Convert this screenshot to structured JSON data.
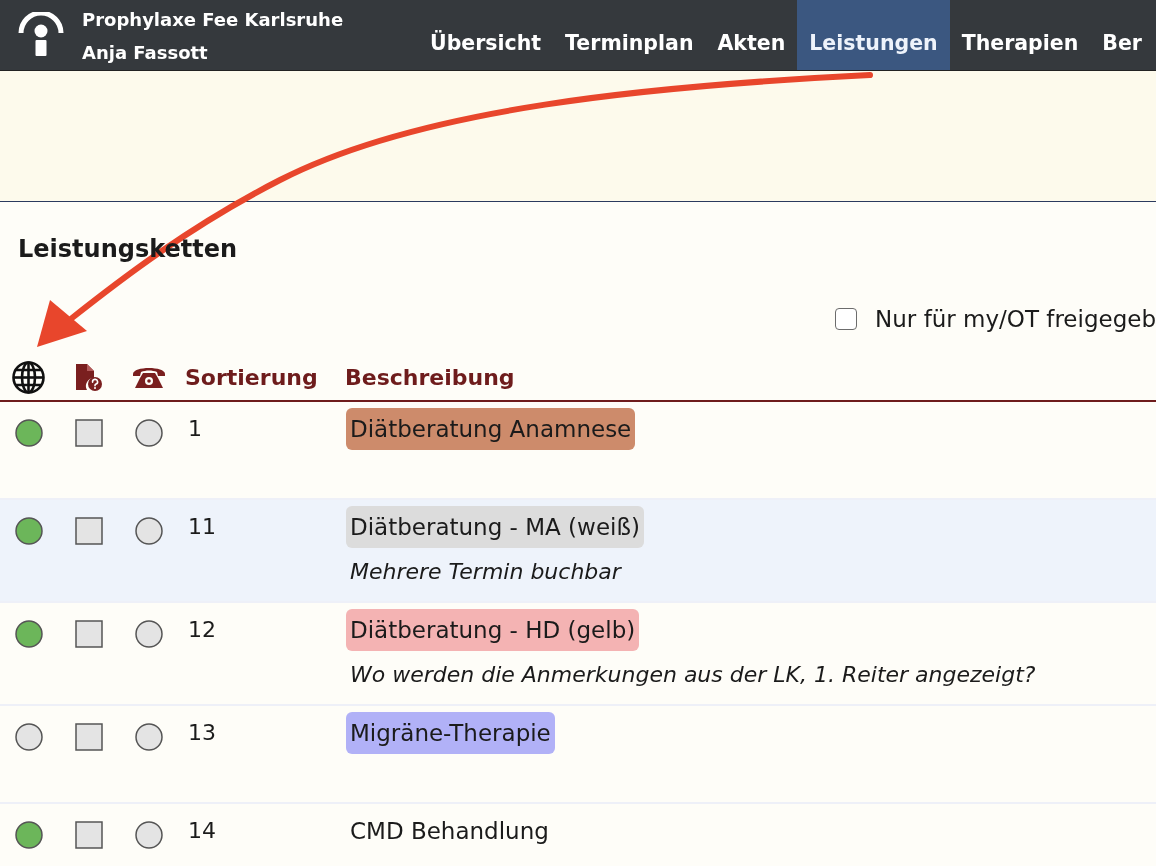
{
  "header": {
    "practice": "Prophylaxe Fee Karlsruhe",
    "user": "Anja Fassott"
  },
  "nav": [
    {
      "label": "Übersicht",
      "selected": false
    },
    {
      "label": "Terminplan",
      "selected": false
    },
    {
      "label": "Akten",
      "selected": false
    },
    {
      "label": "Leistungen",
      "selected": true
    },
    {
      "label": "Therapien",
      "selected": false
    },
    {
      "label": "Ber",
      "selected": false
    }
  ],
  "section": {
    "title": "Leistungsketten"
  },
  "filter": {
    "label": "Nur für my/OT freigegeb",
    "checked": false
  },
  "table": {
    "columns": [
      "Sortierung",
      "Beschreibung"
    ],
    "rows": [
      {
        "online": true,
        "document": false,
        "phone": false,
        "sort": "1",
        "title": "Diätberatung Anamnese",
        "color": "#cd8b6b",
        "selected": false
      },
      {
        "online": true,
        "document": false,
        "phone": false,
        "sort": "11",
        "title": "Diätberatung - MA (weiß)",
        "color": "#dcdcdc",
        "note": "Mehrere Termin buchbar",
        "selected": true
      },
      {
        "online": true,
        "document": false,
        "phone": false,
        "sort": "12",
        "title": "Diätberatung - HD (gelb)",
        "color": "#f4b3b3",
        "note": "Wo werden die Anmerkungen aus der LK, 1. Reiter angezeigt?",
        "selected": false
      },
      {
        "online": false,
        "document": false,
        "phone": false,
        "sort": "13",
        "title": "Migräne-Therapie",
        "color": "#b1b1f7",
        "selected": false
      },
      {
        "online": true,
        "document": false,
        "phone": false,
        "sort": "14",
        "title": "CMD Behandlung",
        "selected": false
      }
    ]
  }
}
